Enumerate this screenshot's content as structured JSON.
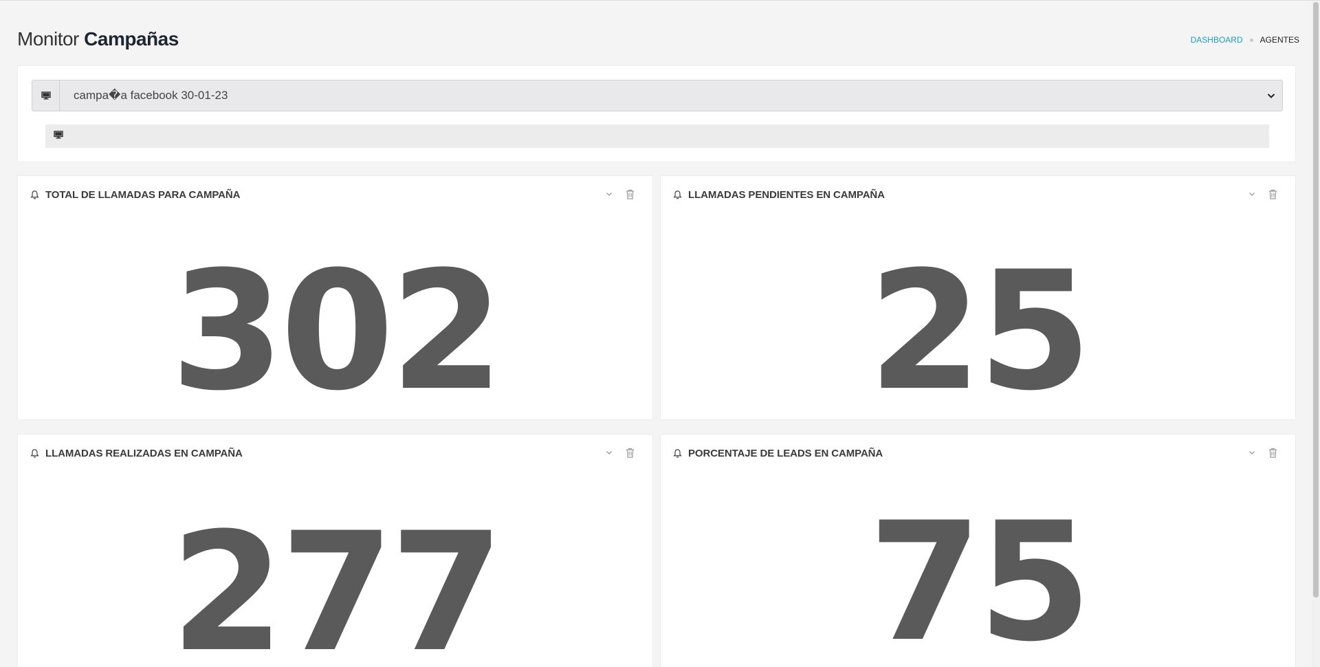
{
  "header": {
    "title_light": "Monitor",
    "title_bold": "Campañas",
    "breadcrumb": {
      "dashboard": "DASHBOARD",
      "agentes": "AGENTES"
    }
  },
  "filters": {
    "campaign_select_value": "campa�a facebook 30-01-23",
    "second_field_value": ""
  },
  "cards": [
    {
      "title": "TOTAL DE LLAMADAS PARA CAMPAÑA",
      "value": "302"
    },
    {
      "title": "LLAMADAS PENDIENTES EN CAMPAÑA",
      "value": "25"
    },
    {
      "title": "LLAMADAS REALIZADAS EN CAMPAÑA",
      "value": "277"
    },
    {
      "title": "PORCENTAJE DE LEADS EN CAMPAÑA",
      "value": "75"
    }
  ],
  "colors": {
    "accent": "#1b9dc4",
    "value_text": "#5a5a5a",
    "panel_bg": "#ffffff",
    "page_bg": "#f4f4f4"
  },
  "icons": {
    "select_addon": "monitor-icon",
    "card_header": "bell-icon",
    "collapse": "chevron-down-icon",
    "delete": "trash-icon"
  }
}
